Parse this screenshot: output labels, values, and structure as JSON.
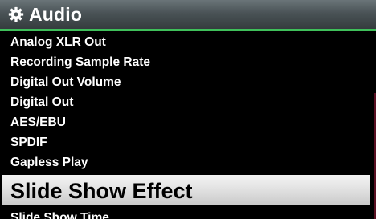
{
  "header": {
    "icon": "gear-icon",
    "title": "Audio"
  },
  "menu": {
    "items": [
      {
        "label": "Analog XLR Out"
      },
      {
        "label": "Recording Sample Rate"
      },
      {
        "label": "Digital Out Volume"
      },
      {
        "label": "Digital Out"
      },
      {
        "label": "AES/EBU"
      },
      {
        "label": "SPDIF"
      },
      {
        "label": "Gapless Play"
      },
      {
        "label": "Slide Show Effect",
        "selected": true
      },
      {
        "label": "Slide Show Time"
      }
    ]
  },
  "colors": {
    "accent": "#3fbf5a",
    "background": "#000000",
    "selection": "#dedede",
    "scrollbar": "#5a1022"
  }
}
